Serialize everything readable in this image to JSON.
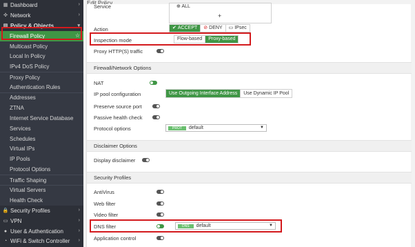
{
  "sidebar": {
    "items": [
      {
        "label": "Dashboard",
        "icon": "dashboard-icon",
        "level": "top"
      },
      {
        "label": "Network",
        "icon": "network-icon",
        "level": "top"
      },
      {
        "label": "Policy & Objects",
        "icon": "policy-icon",
        "level": "top",
        "open": true
      },
      {
        "label": "Firewall Policy",
        "level": "sub",
        "active": true
      },
      {
        "label": "Multicast Policy",
        "level": "sub"
      },
      {
        "label": "Local In Policy",
        "level": "sub"
      },
      {
        "label": "IPv4 DoS Policy",
        "level": "sub"
      },
      {
        "label": "Proxy Policy",
        "level": "sub",
        "sep": true
      },
      {
        "label": "Authentication Rules",
        "level": "sub"
      },
      {
        "label": "Addresses",
        "level": "sub",
        "sep": true
      },
      {
        "label": "ZTNA",
        "level": "sub"
      },
      {
        "label": "Internet Service Database",
        "level": "sub"
      },
      {
        "label": "Services",
        "level": "sub"
      },
      {
        "label": "Schedules",
        "level": "sub"
      },
      {
        "label": "Virtual IPs",
        "level": "sub"
      },
      {
        "label": "IP Pools",
        "level": "sub"
      },
      {
        "label": "Protocol Options",
        "level": "sub"
      },
      {
        "label": "Traffic Shaping",
        "level": "sub",
        "sep": true
      },
      {
        "label": "Virtual Servers",
        "level": "sub",
        "sep": true
      },
      {
        "label": "Health Check",
        "level": "sub"
      },
      {
        "label": "Security Profiles",
        "icon": "lock-icon",
        "level": "top"
      },
      {
        "label": "VPN",
        "icon": "monitor-icon",
        "level": "top"
      },
      {
        "label": "User & Authentication",
        "icon": "user-icon",
        "level": "top"
      },
      {
        "label": "WiFi & Switch Controller",
        "icon": "wifi-icon",
        "level": "top"
      }
    ]
  },
  "header": {
    "title": "Edit Policy"
  },
  "form": {
    "service_label": "Service",
    "service_value": "ALL",
    "service_add": "+",
    "action_label": "Action",
    "action_options": [
      "ACCEPT",
      "DENY",
      "IPsec"
    ],
    "inspection_label": "Inspection mode",
    "inspection_options": [
      "Flow-based",
      "Proxy-based"
    ],
    "proxy_traffic_label": "Proxy HTTP(S) traffic",
    "fw_section": "Firewall/Network Options",
    "nat_label": "NAT",
    "ippool_label": "IP pool configuration",
    "ippool_options": [
      "Use Outgoing Interface Address",
      "Use Dynamic IP Pool"
    ],
    "preserve_label": "Preserve source port",
    "passive_label": "Passive health check",
    "protocol_label": "Protocol options",
    "protocol_tag": "PROT",
    "protocol_value": "default",
    "disclaimer_section": "Disclaimer Options",
    "display_disclaimer_label": "Display disclaimer",
    "security_section": "Security Profiles",
    "antivirus_label": "AntiVirus",
    "webfilter_label": "Web filter",
    "videofilter_label": "Video filter",
    "dnsfilter_label": "DNS filter",
    "dns_tag": "DNS",
    "dns_value": "default",
    "appcontrol_label": "Application control"
  },
  "colors": {
    "accent": "#3f9645",
    "highlight": "#d3191c",
    "sidebar": "#2d3038"
  }
}
